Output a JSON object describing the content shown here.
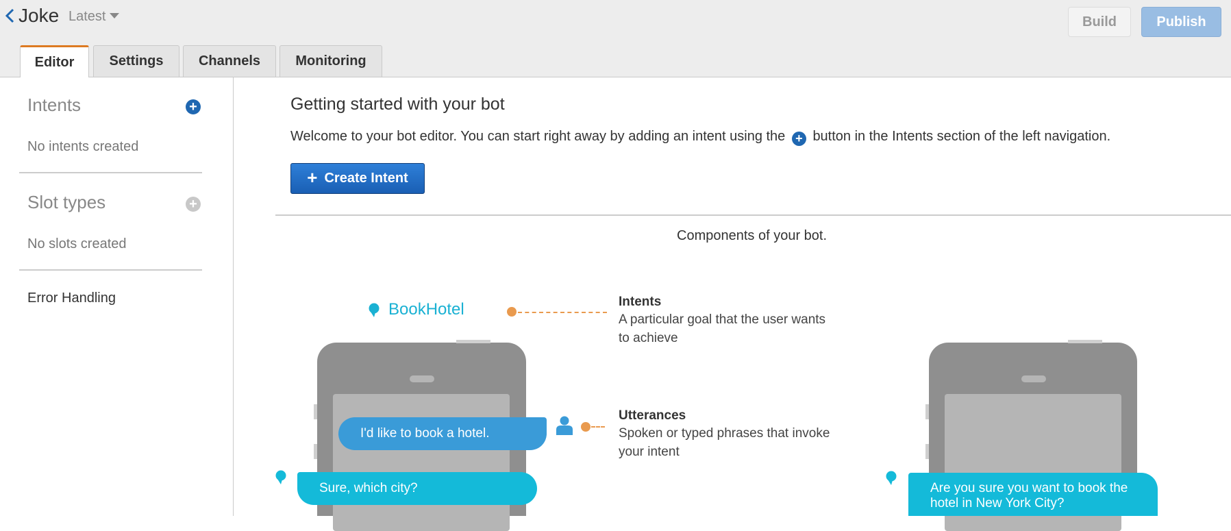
{
  "header": {
    "bot_name": "Joke",
    "version": "Latest",
    "build_label": "Build",
    "publish_label": "Publish",
    "tabs": [
      {
        "label": "Editor",
        "active": true
      },
      {
        "label": "Settings",
        "active": false
      },
      {
        "label": "Channels",
        "active": false
      },
      {
        "label": "Monitoring",
        "active": false
      }
    ]
  },
  "sidebar": {
    "intents_title": "Intents",
    "intents_empty": "No intents created",
    "slot_types_title": "Slot types",
    "slots_empty": "No slots created",
    "error_handling": "Error Handling"
  },
  "main": {
    "title": "Getting started with your bot",
    "desc_before": "Welcome to your bot editor. You can start right away by adding an intent using the",
    "desc_after": "button in the Intents section of the left navigation.",
    "create_intent_label": "Create Intent",
    "components_title": "Components of your bot."
  },
  "illustration": {
    "intent_name": "BookHotel",
    "user_utterance": "I'd like to book a hotel.",
    "bot_prompt": "Sure, which city?",
    "confirm_line1": "Are you sure you want to book the",
    "confirm_line2": "hotel in New York City?",
    "legend": {
      "intents_title": "Intents",
      "intents_line1": "A particular goal that the user wants",
      "intents_line2": "to achieve",
      "utterances_title": "Utterances",
      "utterances_line1": "Spoken or typed phrases that invoke",
      "utterances_line2": "your intent"
    }
  },
  "colors": {
    "accent_tab": "#dd7a22",
    "primary_blue": "#1f67b1",
    "bubble_user": "#3a9bd8",
    "bubble_bot": "#14bad9",
    "connector": "#e99a4e"
  }
}
